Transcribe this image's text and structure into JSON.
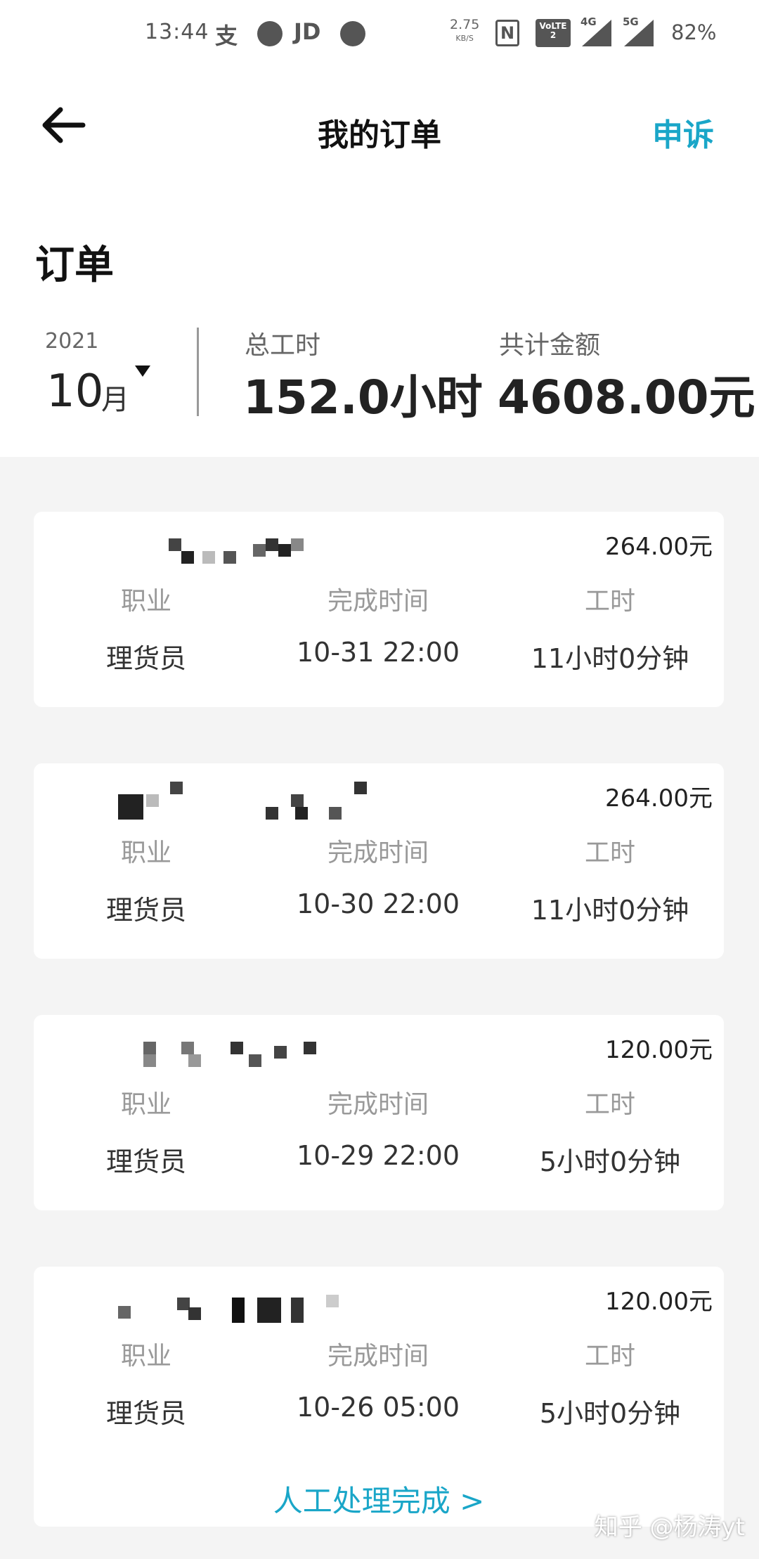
{
  "status_bar": {
    "time": "13:44",
    "icons": [
      "alipay-icon",
      "notification-circle-icon",
      "jd-icon",
      "blocked-icon"
    ],
    "alipay_glyph": "支",
    "jd_glyph": "JD",
    "net_speed_value": "2.75",
    "net_speed_unit": "KB/S",
    "nfc": "N",
    "volte": "VoLTE 2",
    "sig1": "4G",
    "sig2": "5G",
    "battery": "82%"
  },
  "header": {
    "title": "我的订单",
    "appeal_label": "申诉"
  },
  "summary": {
    "section_title": "订单",
    "year": "2021",
    "month": "10",
    "month_unit": "月",
    "total_hours_label": "总工时",
    "total_hours_value": "152.0小时",
    "total_amount_label": "共计金额",
    "total_amount_value": "4608.00元"
  },
  "orders": [
    {
      "amount": "264.00元",
      "job_label": "职业",
      "job": "理货员",
      "time_label": "完成时间",
      "time": "10-31 22:00",
      "hours_label": "工时",
      "hours": "11小时0分钟"
    },
    {
      "amount": "264.00元",
      "job_label": "职业",
      "job": "理货员",
      "time_label": "完成时间",
      "time": "10-30 22:00",
      "hours_label": "工时",
      "hours": "11小时0分钟"
    },
    {
      "amount": "120.00元",
      "job_label": "职业",
      "job": "理货员",
      "time_label": "完成时间",
      "time": "10-29 22:00",
      "hours_label": "工时",
      "hours": "5小时0分钟"
    },
    {
      "amount": "120.00元",
      "job_label": "职业",
      "job": "理货员",
      "time_label": "完成时间",
      "time": "10-26 05:00",
      "hours_label": "工时",
      "hours": "5小时0分钟",
      "link": "人工处理完成 >"
    }
  ],
  "watermark": "知乎 @杨涛yt",
  "colors": {
    "accent": "#1aa6c8",
    "background": "#f4f4f4",
    "card": "#ffffff"
  }
}
